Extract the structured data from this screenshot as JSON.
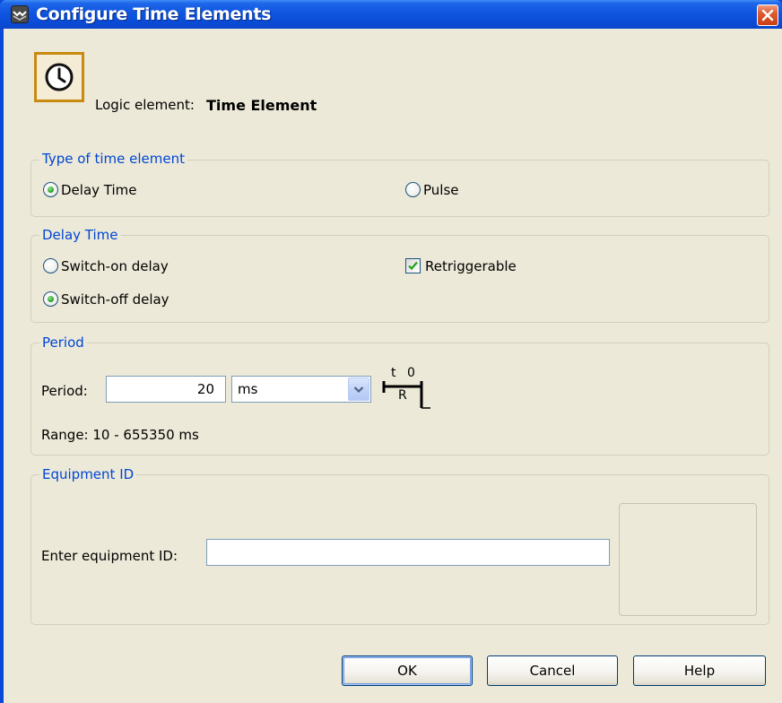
{
  "window": {
    "title": "Configure Time Elements"
  },
  "header": {
    "logic_label": "Logic element:",
    "logic_value": "Time Element",
    "icon": "clock-icon"
  },
  "type_group": {
    "title": "Type of time element",
    "options": [
      {
        "label": "Delay Time",
        "checked": true
      },
      {
        "label": "Pulse",
        "checked": false
      }
    ]
  },
  "delay_group": {
    "title": "Delay Time",
    "options": [
      {
        "label": "Switch-on delay",
        "checked": false
      },
      {
        "label": "Switch-off delay",
        "checked": true
      }
    ],
    "retriggerable": {
      "label": "Retriggerable",
      "checked": true
    }
  },
  "period_group": {
    "title": "Period",
    "period_label": "Period:",
    "period_value": "20",
    "unit_value": "ms",
    "diagram": {
      "t": "t",
      "zero": "0",
      "r": "R"
    },
    "range_text": "Range: 10 - 655350 ms"
  },
  "equipment_group": {
    "title": "Equipment ID",
    "field_label": "Enter equipment ID:",
    "field_value": ""
  },
  "buttons": {
    "ok": "OK",
    "cancel": "Cancel",
    "help": "Help"
  },
  "colors": {
    "titlebar": "#0a4bd6",
    "group_title": "#0046d5",
    "dialog_bg": "#ece9d8"
  }
}
